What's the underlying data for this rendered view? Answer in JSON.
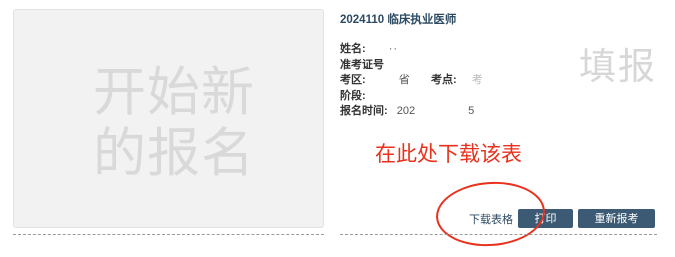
{
  "new_registration": {
    "label_line1": "开始新",
    "label_line2": "的报名"
  },
  "card": {
    "title": "2024110 临床执业医师",
    "watermark": "填报",
    "fields": {
      "name_label": "姓名:",
      "name_value": "··",
      "id_label": "准考证号",
      "id_value": "",
      "area_label": "考区:",
      "area_value": "省",
      "point_label": "考点:",
      "point_value": "考",
      "stage_label": "阶段:",
      "stage_value": "",
      "time_label": "报名时间:",
      "time_value_start": "202",
      "time_value_end": "5"
    },
    "actions": {
      "download": "下载表格",
      "print": "打印",
      "reapply": "重新报考"
    }
  },
  "annotation": {
    "text": "在此处下载该表",
    "color": "#e8321e"
  },
  "colors": {
    "button": "#3c5a73",
    "title": "#2d4a63",
    "annotation": "#e8321e"
  }
}
